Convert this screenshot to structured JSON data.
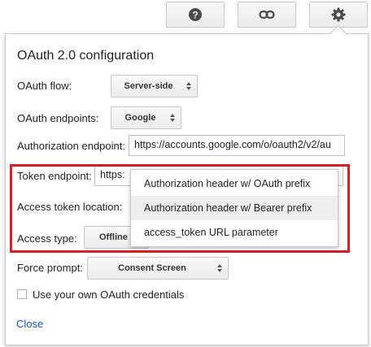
{
  "toolbar": {
    "help_icon": "help-circle-icon",
    "link_icon": "link-icon",
    "settings_icon": "gear-icon"
  },
  "panel": {
    "title": "OAuth 2.0 configuration",
    "oauth_flow": {
      "label": "OAuth flow:",
      "value": "Server-side"
    },
    "oauth_endpoints": {
      "label": "OAuth endpoints:",
      "value": "Google"
    },
    "authorization_endpoint": {
      "label": "Authorization endpoint:",
      "value": "https://accounts.google.com/o/oauth2/v2/au"
    },
    "token_endpoint": {
      "label": "Token endpoint:",
      "value": "https:"
    },
    "access_token_location": {
      "label": "Access token location:"
    },
    "access_type": {
      "label": "Access type:",
      "value": "Offline"
    },
    "force_prompt": {
      "label": "Force prompt:",
      "value": "Consent Screen"
    },
    "own_credentials": {
      "label": "Use your own OAuth credentials",
      "checked": false
    },
    "close_link": "Close"
  },
  "dropdown_menu": {
    "items": [
      {
        "label": "Authorization header w/ OAuth prefix",
        "highlighted": false
      },
      {
        "label": "Authorization header w/ Bearer prefix",
        "highlighted": true
      },
      {
        "label": "access_token URL parameter",
        "highlighted": false
      }
    ]
  },
  "colors": {
    "highlight_border": "#d51f26",
    "link": "#1a55c4",
    "icon": "#4a4a4a"
  }
}
